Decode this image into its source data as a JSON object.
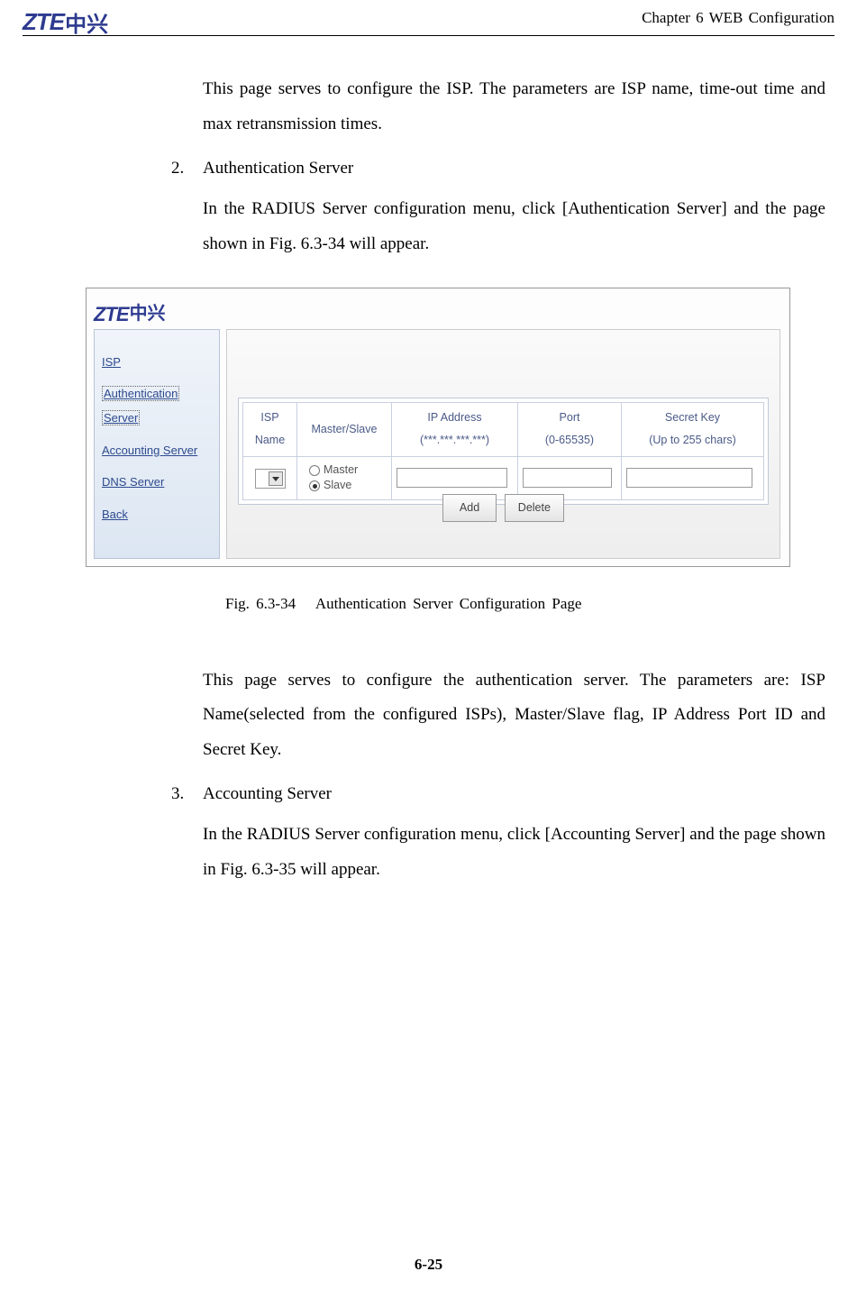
{
  "header": {
    "chapter": "Chapter 6 WEB Configuration",
    "logo_zte": "ZTE",
    "logo_cn": "中兴"
  },
  "body": {
    "p1": "This page serves to configure the ISP. The parameters are ISP name, time-out time and max retransmission times.",
    "item2_num": "2.",
    "item2_title": "Authentication Server",
    "item2_desc": "In the RADIUS Server configuration menu, click [Authentication Server] and the page shown in Fig. 6.3-34 will appear.",
    "p2": "This page serves to configure the authentication server. The parameters are: ISP Name(selected from the configured ISPs), Master/Slave flag, IP Address Port ID and Secret Key.",
    "item3_num": "3.",
    "item3_title": "Accounting Server",
    "item3_desc": "In the RADIUS Server configuration menu, click [Accounting Server] and the page shown in Fig. 6.3-35 will appear."
  },
  "figure": {
    "caption_num": "Fig. 6.3-34",
    "caption_text": "Authentication Server Configuration Page",
    "sidebar": {
      "isp": "ISP",
      "auth1": "Authentication",
      "auth2": "Server",
      "acct": "Accounting Server",
      "dns": "DNS Server",
      "back": "Back"
    },
    "table": {
      "col1": "ISP Name",
      "col2": "Master/Slave",
      "col3a": "IP Address",
      "col3b": "(***.***.***.***)",
      "col4a": "Port",
      "col4b": "(0-65535)",
      "col5a": "Secret Key",
      "col5b": "(Up to 255 chars)",
      "master": "Master",
      "slave": "Slave"
    },
    "buttons": {
      "add": "Add",
      "delete": "Delete"
    }
  },
  "page_num": "6-25"
}
